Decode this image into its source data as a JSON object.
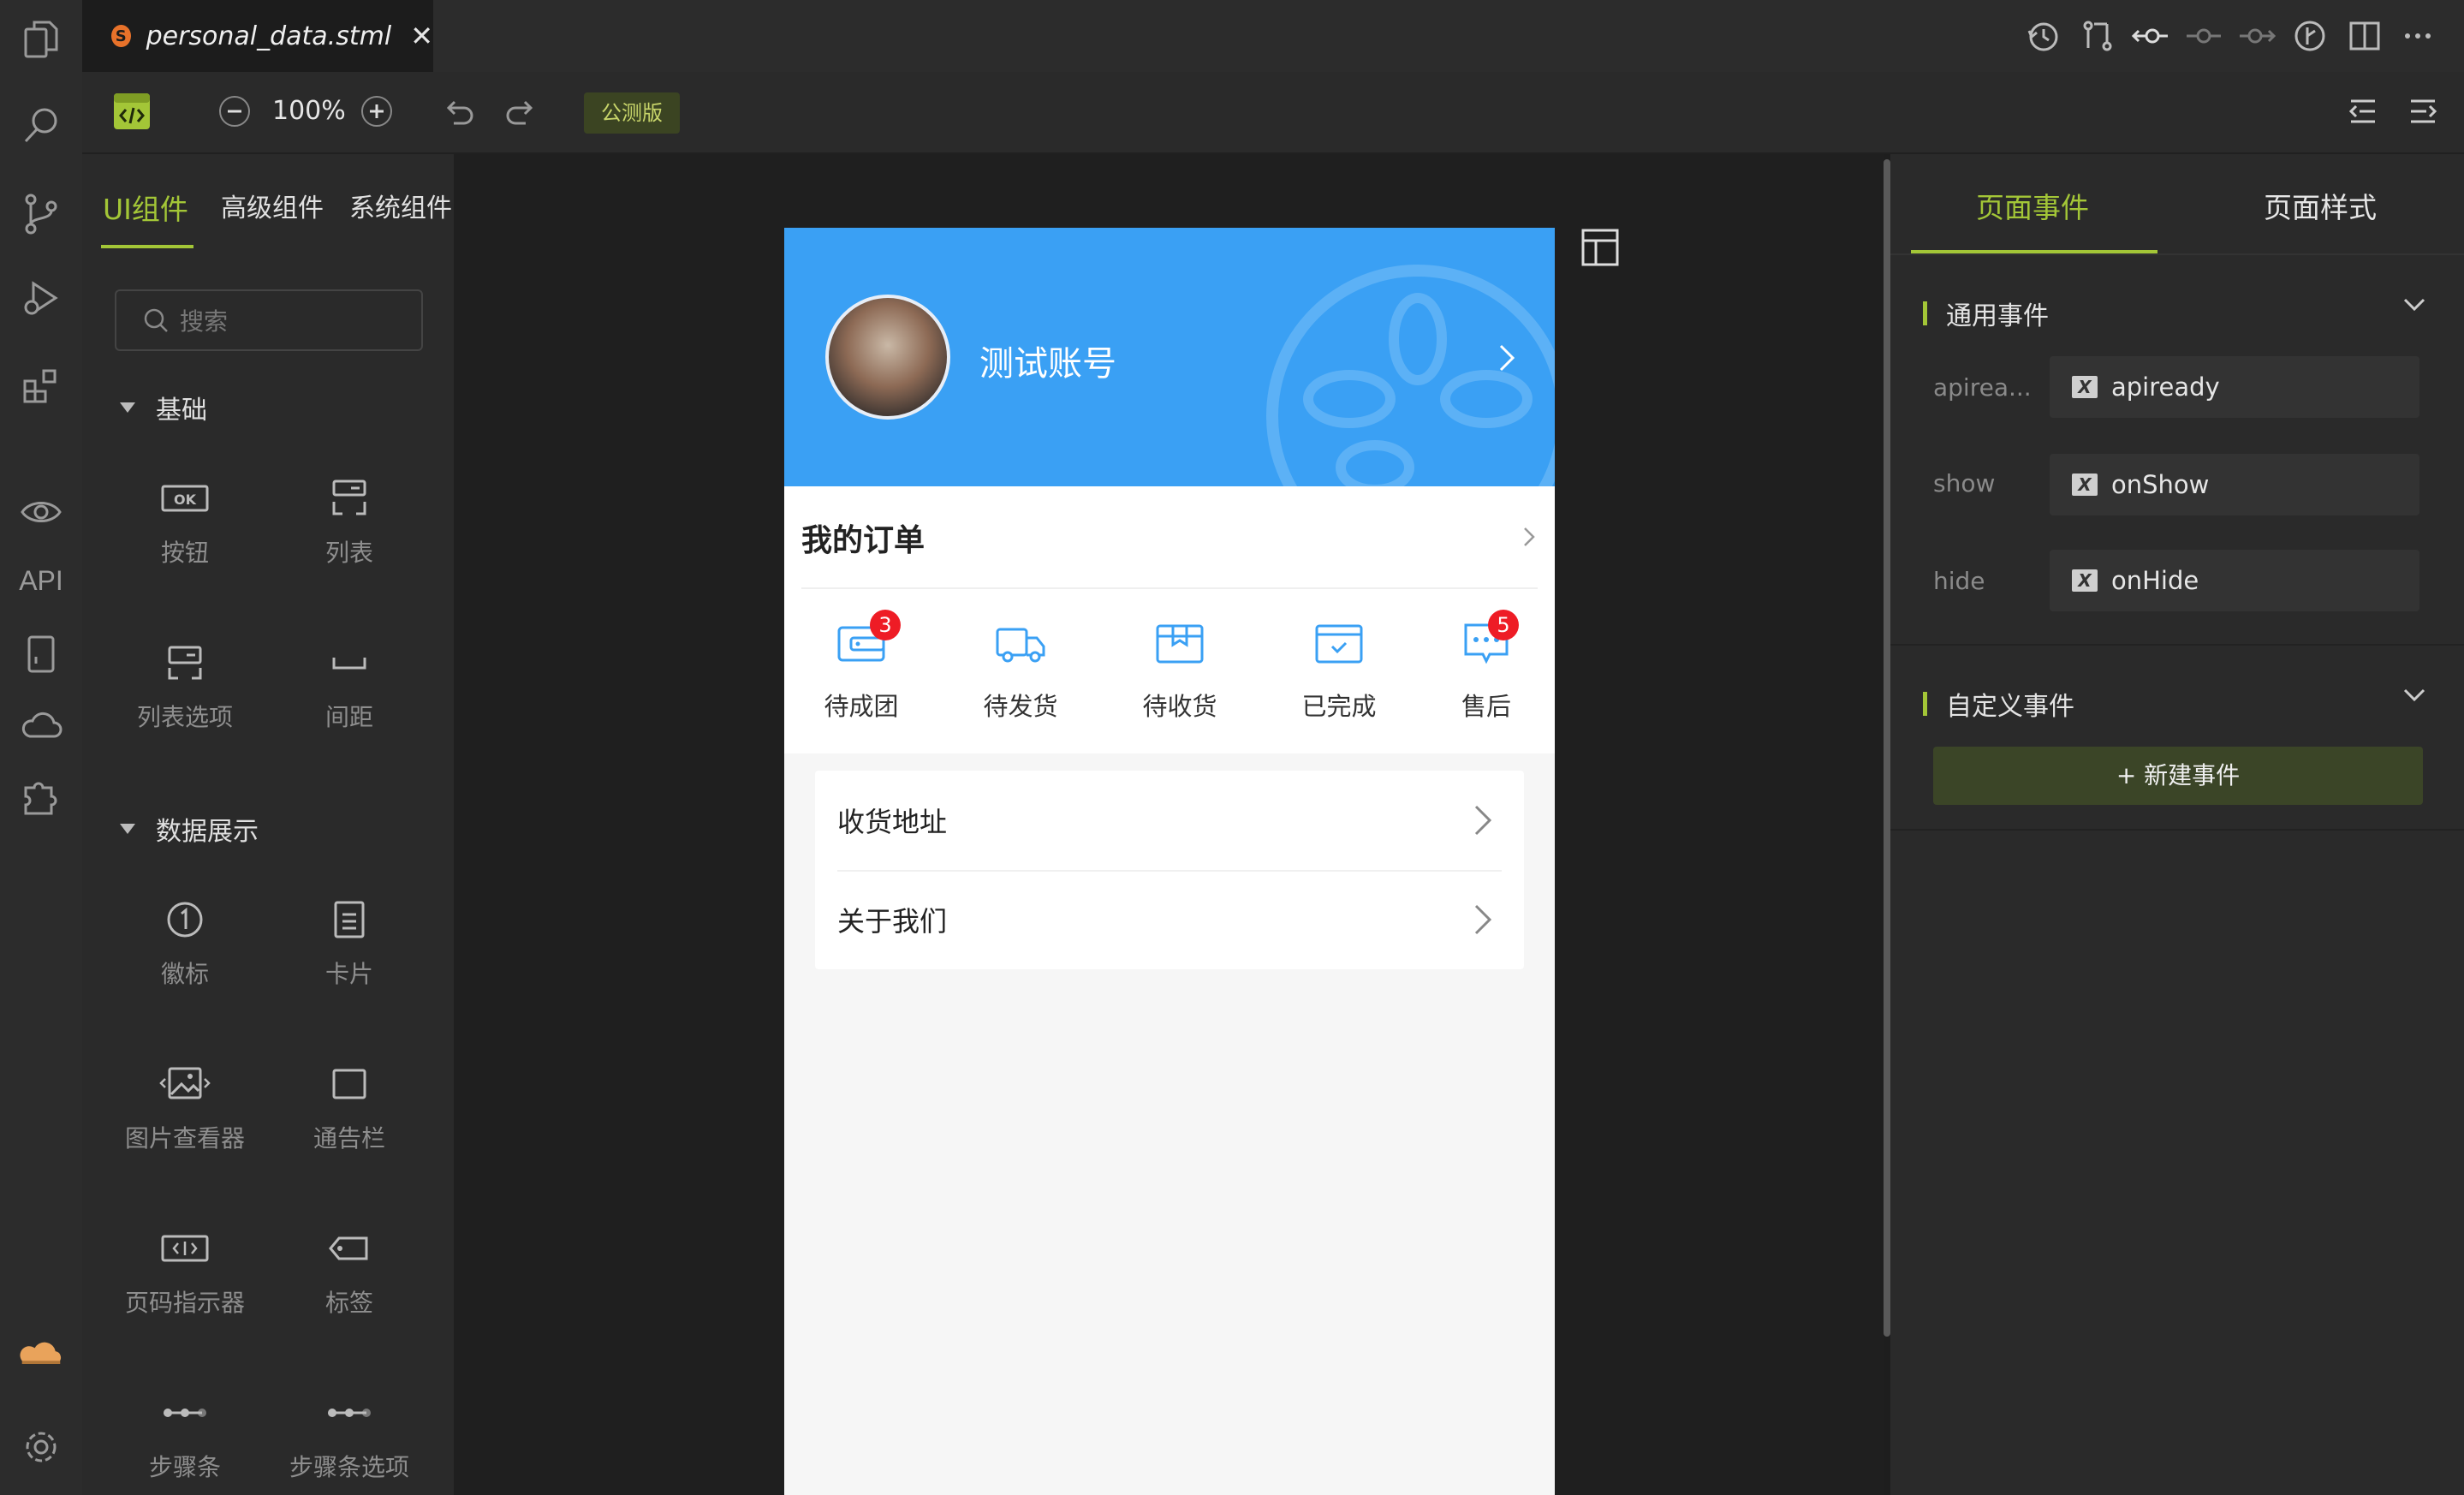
{
  "tab": {
    "file_name": "personal_data.stml",
    "file_badge": "S",
    "close": "✕"
  },
  "activity_bar": {
    "api_label": "API"
  },
  "toolbar": {
    "zoom": "100%",
    "release_badge": "公测版"
  },
  "left_panel": {
    "tabs": [
      "UI组件",
      "高级组件",
      "系统组件"
    ],
    "search_placeholder": "搜索",
    "sections": [
      {
        "title": "基础",
        "items": [
          "按钮",
          "列表",
          "列表选项",
          "间距"
        ]
      },
      {
        "title": "数据展示",
        "items": [
          "徽标",
          "卡片",
          "图片查看器",
          "通告栏",
          "页码指示器",
          "标签",
          "步骤条",
          "步骤条选项"
        ]
      }
    ],
    "button_icon_text": "OK"
  },
  "phone": {
    "account_name": "测试账号",
    "orders_title": "我的订单",
    "orders": [
      {
        "label": "待成团",
        "badge": "3"
      },
      {
        "label": "待发货",
        "badge": ""
      },
      {
        "label": "待收货",
        "badge": ""
      },
      {
        "label": "已完成",
        "badge": ""
      },
      {
        "label": "售后",
        "badge": "5"
      }
    ],
    "menu": [
      "收货地址",
      "关于我们"
    ],
    "accent_color": "#3aa0f4"
  },
  "right_panel": {
    "tabs": [
      "页面事件",
      "页面样式"
    ],
    "common_events_title": "通用事件",
    "events": [
      {
        "name": "apirea...",
        "handler": "apiready"
      },
      {
        "name": "show",
        "handler": "onShow"
      },
      {
        "name": "hide",
        "handler": "onHide"
      }
    ],
    "custom_events_title": "自定义事件",
    "new_event_button": "+ 新建事件",
    "accent_color": "#a3c637"
  }
}
